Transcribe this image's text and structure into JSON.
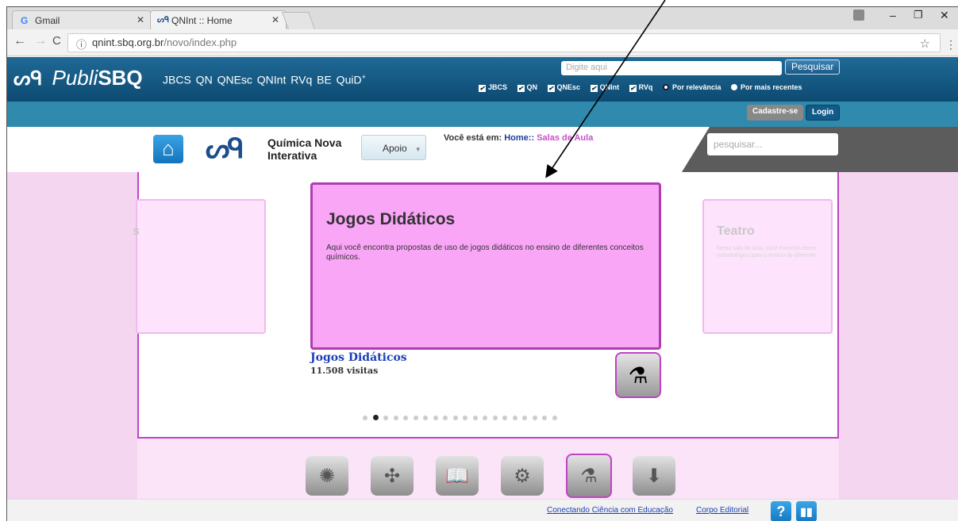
{
  "browser": {
    "tabs": [
      {
        "icon": "G",
        "title": "Gmail"
      },
      {
        "icon": "sq",
        "title": "QNInt :: Home"
      }
    ],
    "url_host": "qnint.sbq.org.br",
    "url_path": "/novo/index.php"
  },
  "publisbq": {
    "logo_prefix": "Publi",
    "logo_bold": "SBQ",
    "journals": "JBCS  QN  QNEsc  QNInt  RVq  BE  QuiD",
    "journals_sup": "+",
    "search_placeholder": "Digite aqui",
    "search_button": "Pesquisar",
    "filters": [
      "JBCS",
      "QN",
      "QNEsc",
      "QNInt",
      "RVq"
    ],
    "sort_options": [
      "Por relevância",
      "Por mais recentes"
    ],
    "register": "Cadastre-se",
    "login": "Login"
  },
  "qnint": {
    "logo_mark": "ᔕᑫ",
    "name_line1": "Química Nova",
    "name_line2": "Interativa",
    "apoio": "Apoio",
    "breadcrumb_label": "Você está em:",
    "breadcrumb_home": "Home::",
    "breadcrumb_section": "Salas de Aula",
    "search_placeholder": "pesquisar..."
  },
  "carousel": {
    "left_card_title": "s",
    "right_card_title": "Teatro",
    "right_card_desc1": "Nesta sala de aula, você encontra exem",
    "right_card_desc2": "metodológico para o ensino de diferente",
    "main_title": "Jogos Didáticos",
    "main_desc": "Aqui você encontra propostas de uso de jogos didáticos no ensino de diferentes conceitos químicos.",
    "caption_title": "Jogos Didáticos",
    "caption_visits": "11.508 visitas",
    "dots_total": 20,
    "active_dot": 2
  },
  "bottom_icons": [
    "molecule-network-icon",
    "atom-model-icon",
    "book-icon",
    "brain-gear-icon",
    "lab-glassware-icon",
    "download-box-icon"
  ],
  "footer": {
    "link1": "Conectando Ciência com Educação",
    "link2": "Corpo Editorial",
    "help": "?"
  },
  "colors": {
    "publisbq_blue": "#165c88",
    "accent_magenta": "#c043c4",
    "card_pink": "#f9a6f7",
    "background_pink": "#f5d6f0",
    "link_blue": "#1c3fb8"
  }
}
